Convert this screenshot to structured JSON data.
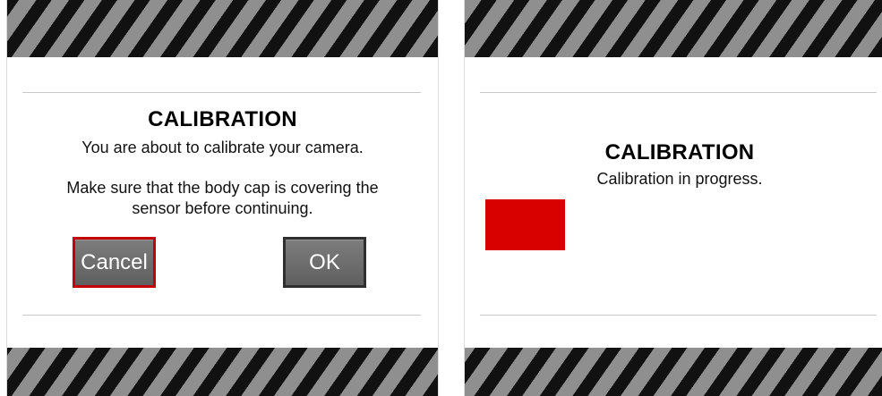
{
  "left_dialog": {
    "title": "CALIBRATION",
    "message": "You are about to calibrate your camera.",
    "instruction_line1": "Make sure that the body cap is covering the",
    "instruction_line2": "sensor before continuing.",
    "cancel_label": "Cancel",
    "ok_label": "OK"
  },
  "right_dialog": {
    "title": "CALIBRATION",
    "status": "Calibration in progress."
  },
  "colors": {
    "focus_border": "#c40000",
    "progress_fill": "#d90000",
    "stripe_dark": "#111111",
    "stripe_light": "#8f8f8f"
  }
}
